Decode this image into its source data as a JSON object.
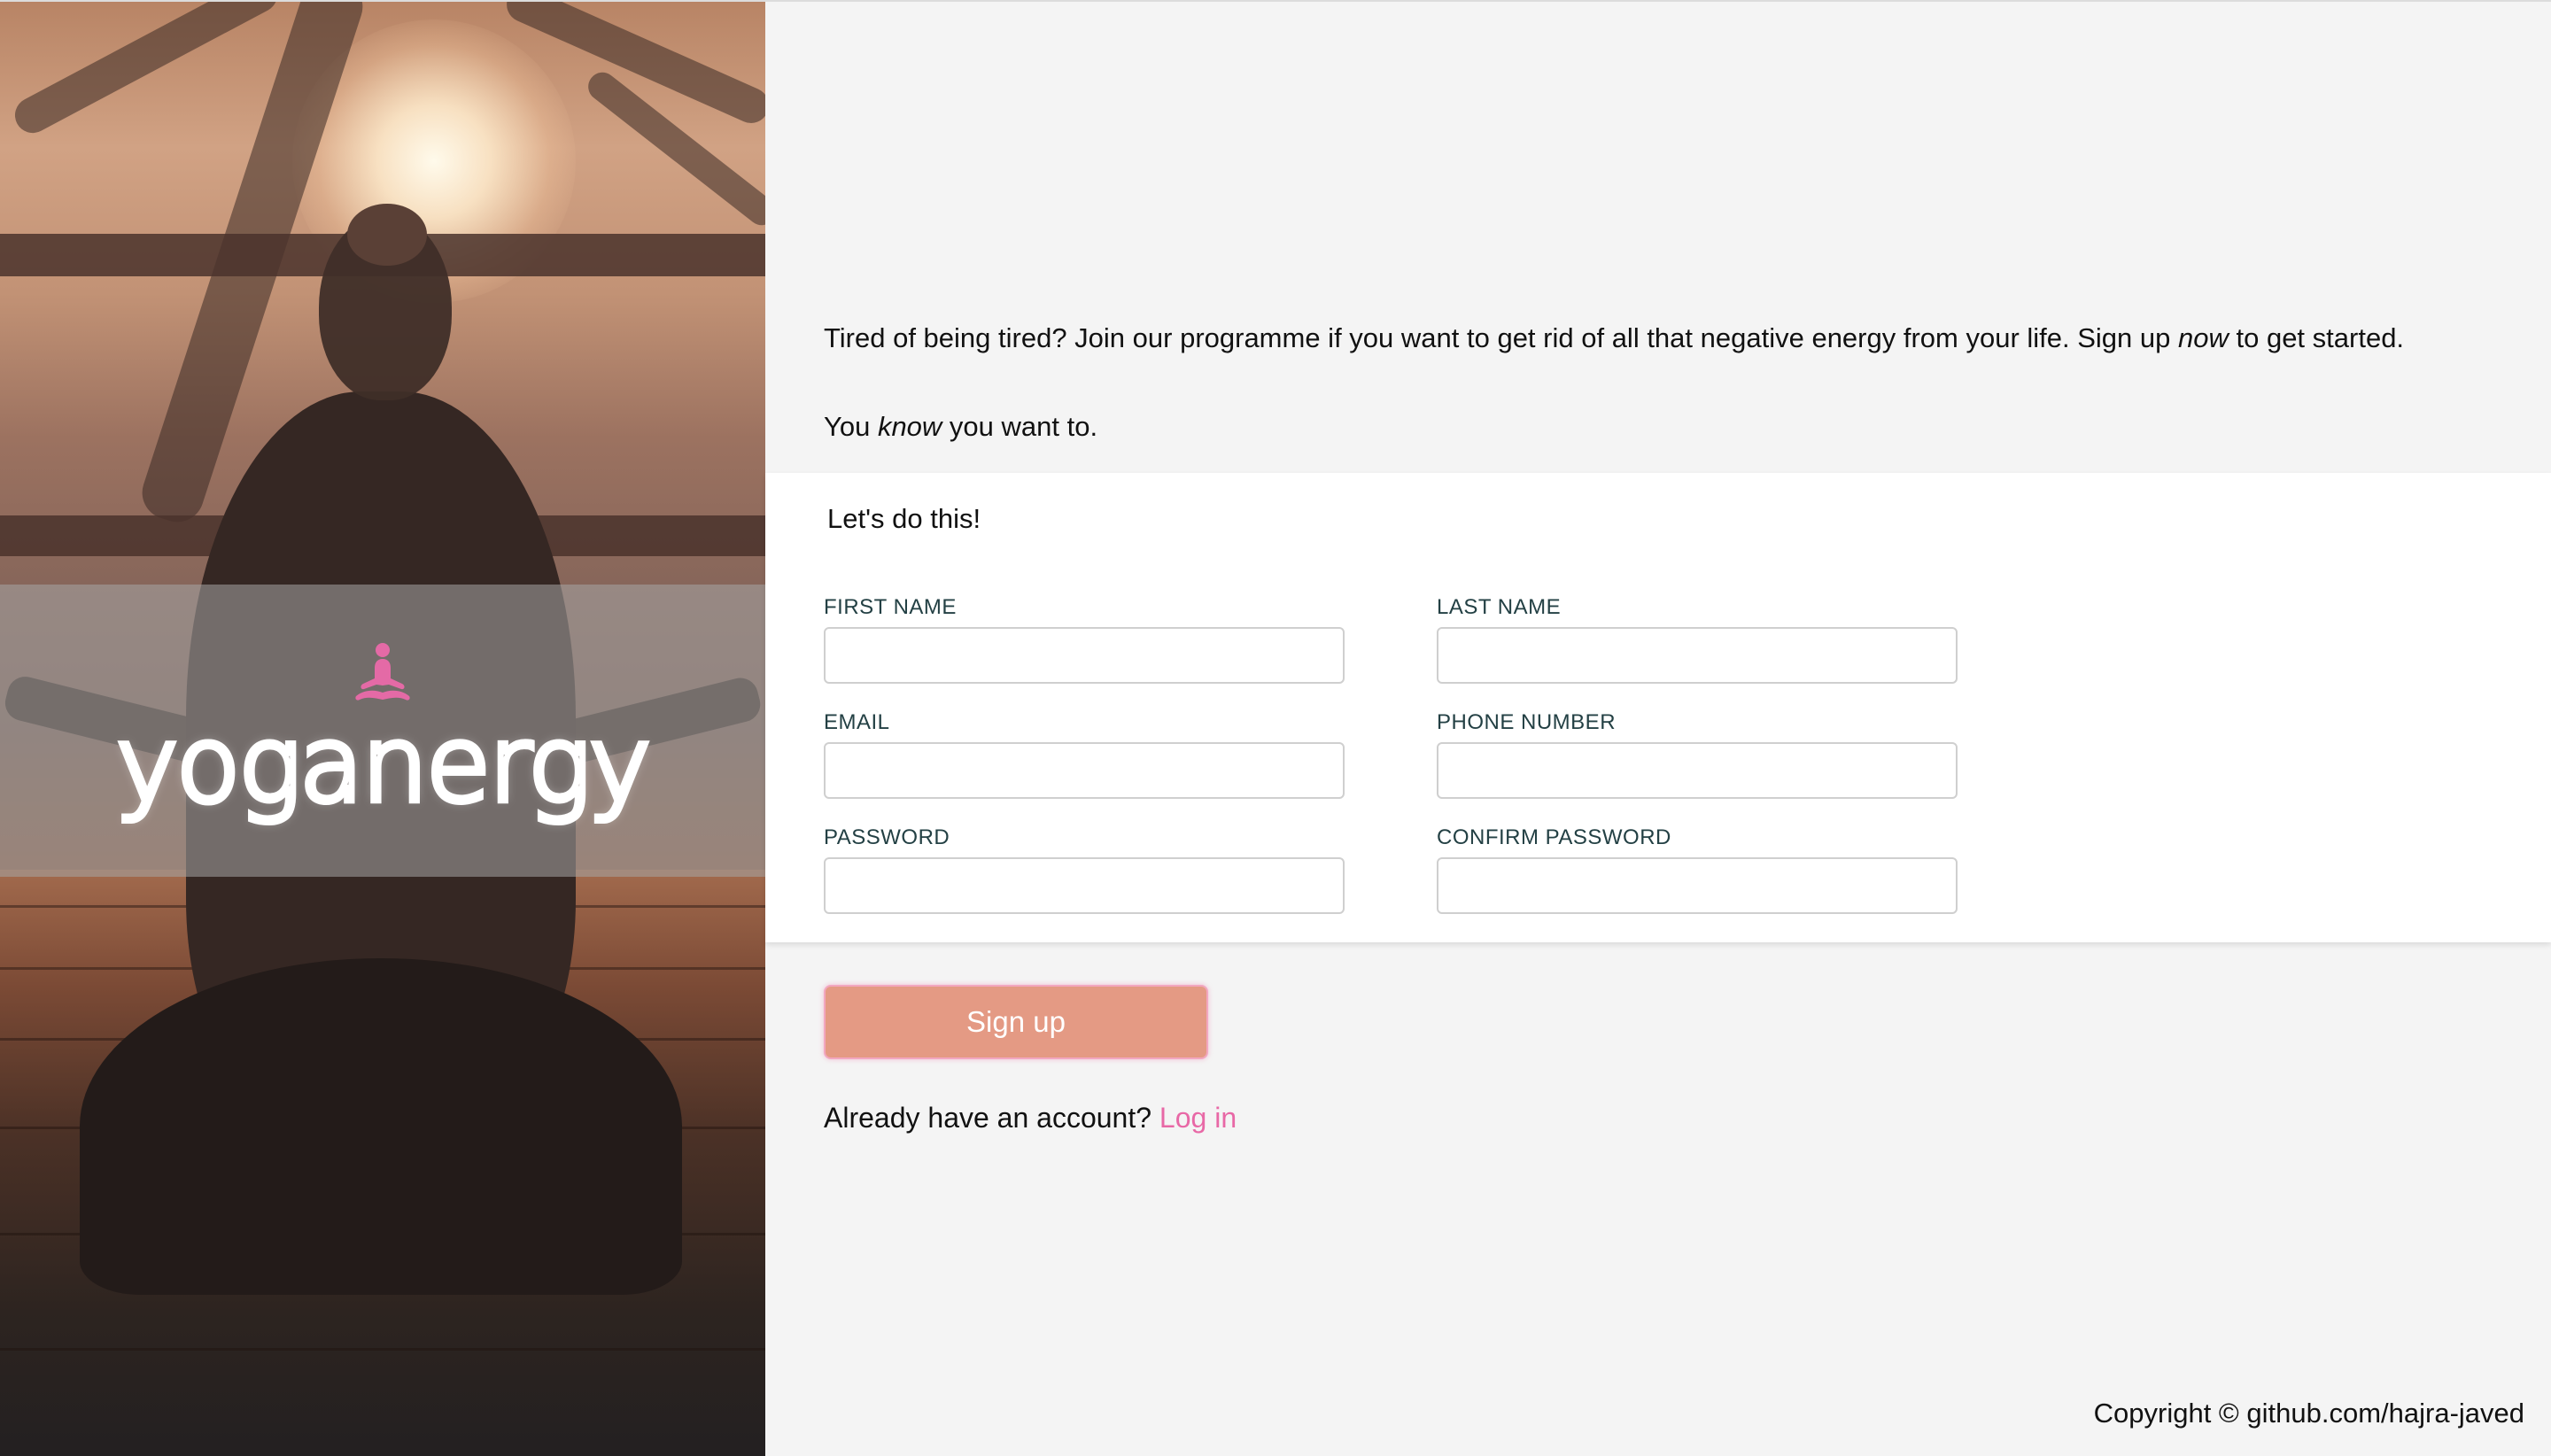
{
  "brand": {
    "name": "yoganergy",
    "icon": "meditation-icon",
    "icon_color": "#e46aa6"
  },
  "intro": {
    "line1_pre": "Tired of being tired? Join our programme if you want to get rid of all that negative energy from your life. Sign up ",
    "line1_em": "now",
    "line1_post": " to get started.",
    "line2_pre": "You ",
    "line2_em": "know",
    "line2_post": " you want to."
  },
  "form": {
    "title": "Let's do this!",
    "fields": {
      "first_name": {
        "label": "FIRST NAME",
        "value": ""
      },
      "last_name": {
        "label": "LAST NAME",
        "value": ""
      },
      "email": {
        "label": "EMAIL",
        "value": ""
      },
      "phone": {
        "label": "PHONE NUMBER",
        "value": ""
      },
      "password": {
        "label": "PASSWORD",
        "value": ""
      },
      "confirm_password": {
        "label": "CONFIRM PASSWORD",
        "value": ""
      }
    }
  },
  "actions": {
    "signup_label": "Sign up",
    "login_prompt": "Already have an account? ",
    "login_label": "Log in"
  },
  "footer": {
    "copyright": "Copyright © github.com/hajra-javed"
  },
  "colors": {
    "accent_pink": "#e868a6",
    "button_fill": "#e49a84",
    "label_color": "#234044",
    "page_bg": "#f4f4f4"
  }
}
